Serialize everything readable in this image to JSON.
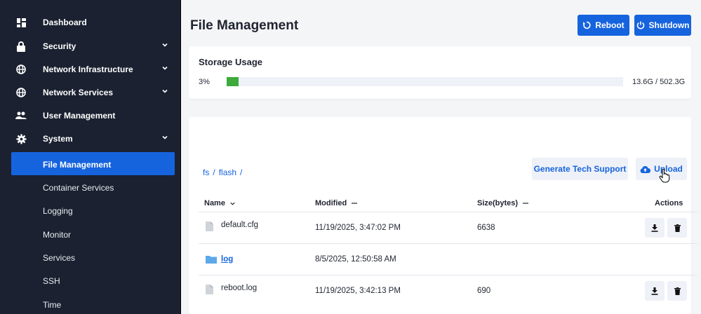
{
  "sidebar": {
    "items": [
      {
        "label": "Dashboard",
        "icon": "dashboard-icon"
      },
      {
        "label": "Security",
        "icon": "lock-icon"
      },
      {
        "label": "Network Infrastructure",
        "icon": "globe-icon"
      },
      {
        "label": "Network Services",
        "icon": "globe-icon"
      },
      {
        "label": "User Management",
        "icon": "users-icon"
      },
      {
        "label": "System",
        "icon": "gear-icon"
      }
    ],
    "system_children": [
      {
        "label": "File Management"
      },
      {
        "label": "Container Services"
      },
      {
        "label": "Logging"
      },
      {
        "label": "Monitor"
      },
      {
        "label": "Services"
      },
      {
        "label": "SSH"
      },
      {
        "label": "Time"
      }
    ]
  },
  "header": {
    "title": "File Management",
    "reboot_label": "Reboot",
    "shutdown_label": "Shutdown"
  },
  "storage": {
    "title": "Storage Usage",
    "percent_label": "3%",
    "percent": 3,
    "capacity": "13.6G / 502.3G"
  },
  "files": {
    "breadcrumb": [
      "fs",
      "flash"
    ],
    "tech_support_label": "Generate Tech Support",
    "upload_label": "Upload",
    "columns": {
      "name": "Name",
      "modified": "Modified",
      "size": "Size(bytes)",
      "actions": "Actions"
    },
    "rows": [
      {
        "name": "default.cfg",
        "type": "file",
        "modified": "11/19/2025, 3:47:02 PM",
        "size": "6638"
      },
      {
        "name": "log",
        "type": "folder",
        "modified": "8/5/2025, 12:50:58 AM",
        "size": ""
      },
      {
        "name": "reboot.log",
        "type": "file",
        "modified": "11/19/2025, 3:42:13 PM",
        "size": "690"
      }
    ]
  },
  "colors": {
    "accent": "#1663de",
    "sidebar_bg": "#1b2130",
    "progress": "#3caa3c"
  }
}
